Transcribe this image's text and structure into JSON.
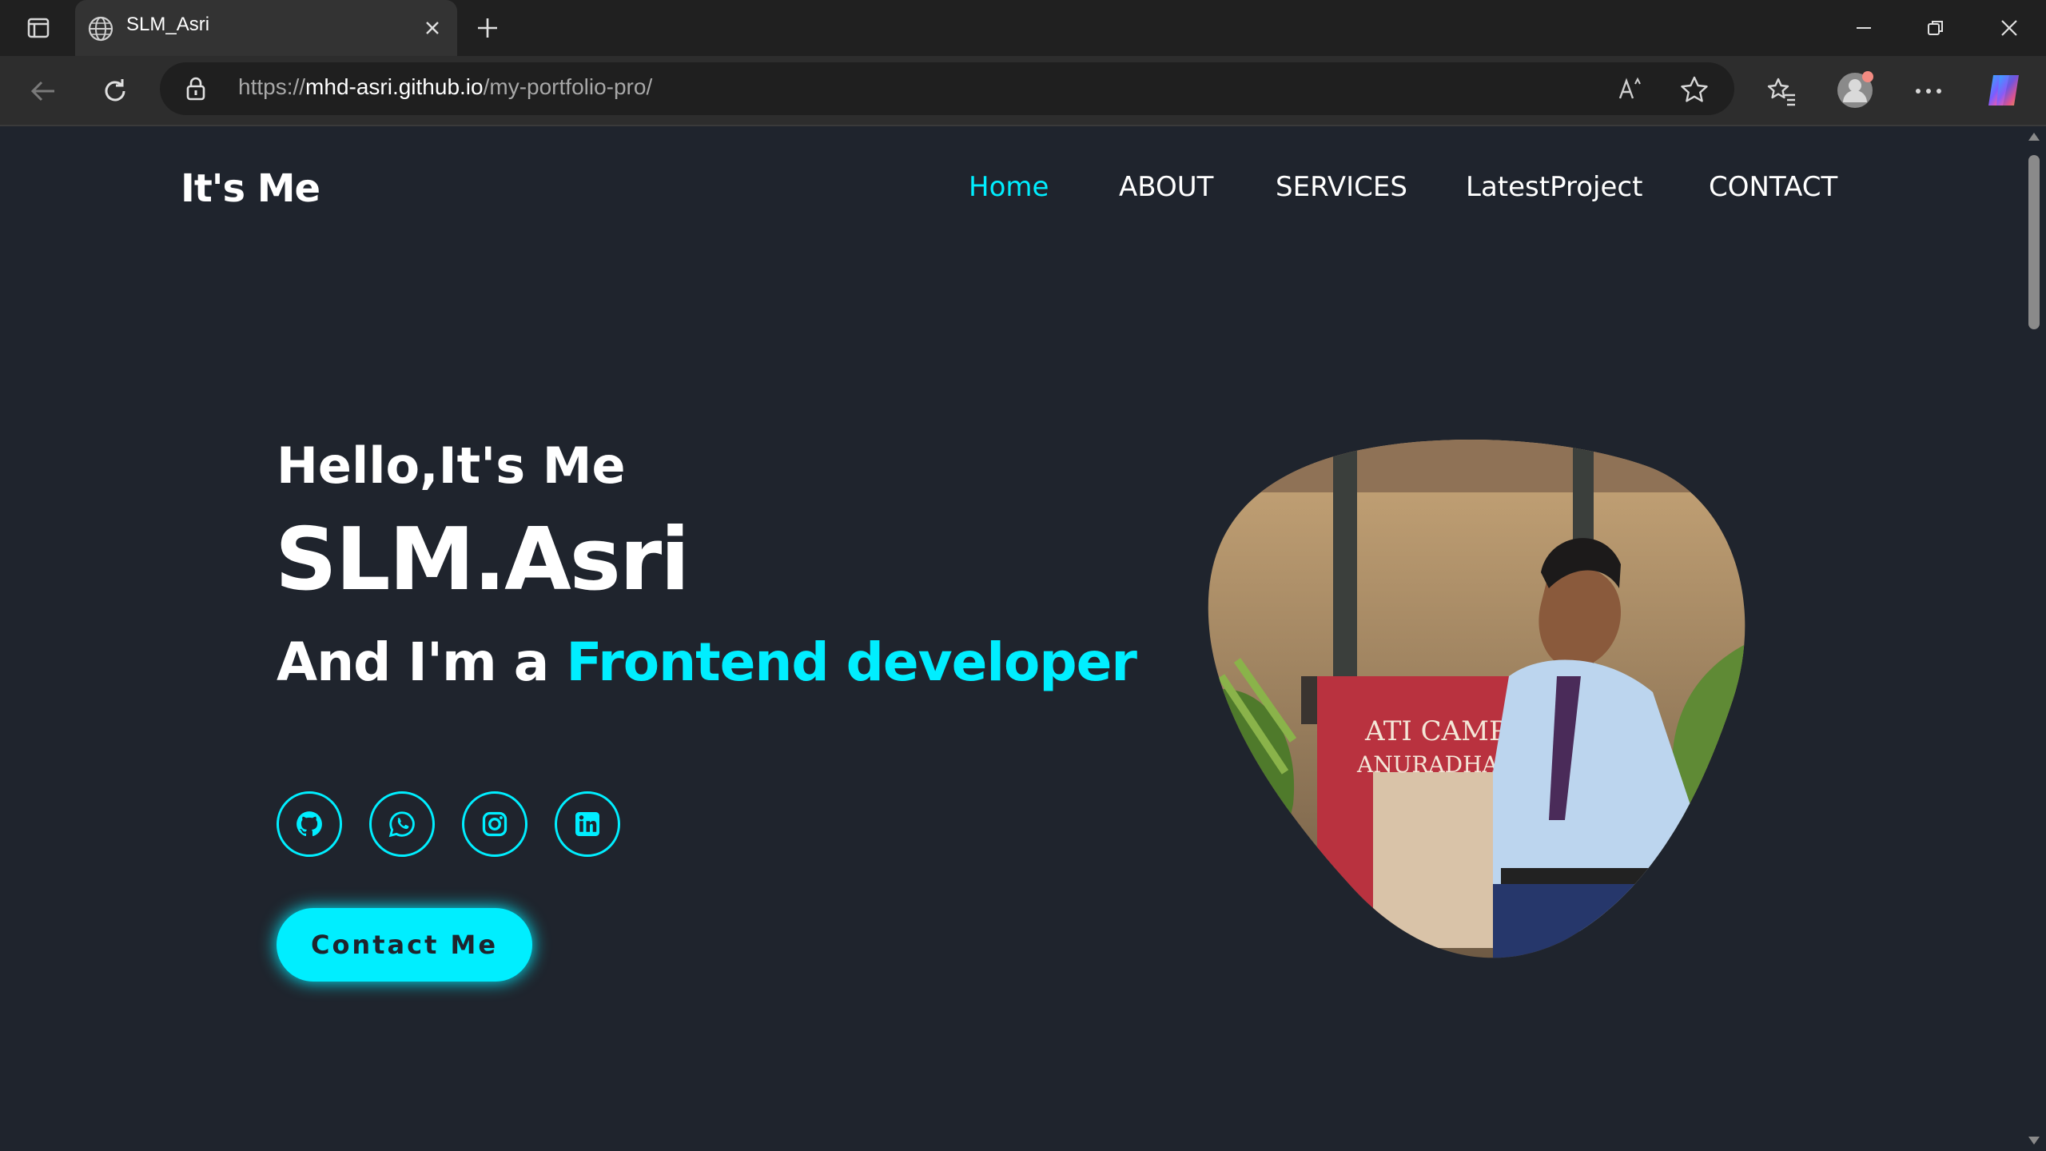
{
  "browser": {
    "tab": {
      "title": "SLM_Asri",
      "favicon": "globe-icon"
    },
    "address": {
      "scheme": "https://",
      "host": "mhd-asri.github.io",
      "path": "/my-portfolio-pro/"
    },
    "icons": [
      "tab-actions-icon",
      "new-tab-icon",
      "back-arrow-icon",
      "refresh-icon",
      "lock-icon",
      "read-aloud-icon",
      "star-icon",
      "favorites-icon",
      "profile-avatar",
      "more-icon",
      "copilot-icon",
      "minimize-icon",
      "restore-icon",
      "close-icon"
    ]
  },
  "page": {
    "logo": "It's Me",
    "nav": [
      {
        "label": "Home",
        "active": true
      },
      {
        "label": "ABOUT",
        "active": false
      },
      {
        "label": "SERVICES",
        "active": false
      },
      {
        "label": "LatestProject",
        "active": false
      },
      {
        "label": "CONTACT",
        "active": false
      }
    ],
    "hero": {
      "greeting": "Hello,It's Me",
      "name": "SLM.Asri",
      "role_prefix": "And I'm a ",
      "role_highlight": "Frontend developer",
      "socials": [
        "github-icon",
        "whatsapp-icon",
        "instagram-icon",
        "linkedin-icon"
      ],
      "cta": "Contact Me",
      "photo_sign": "ATI CAMP ANURADHA"
    }
  },
  "colors": {
    "accent": "#00eeff",
    "background": "#1f242d",
    "text": "#ffffff",
    "chrome": "#2d2d2d"
  }
}
